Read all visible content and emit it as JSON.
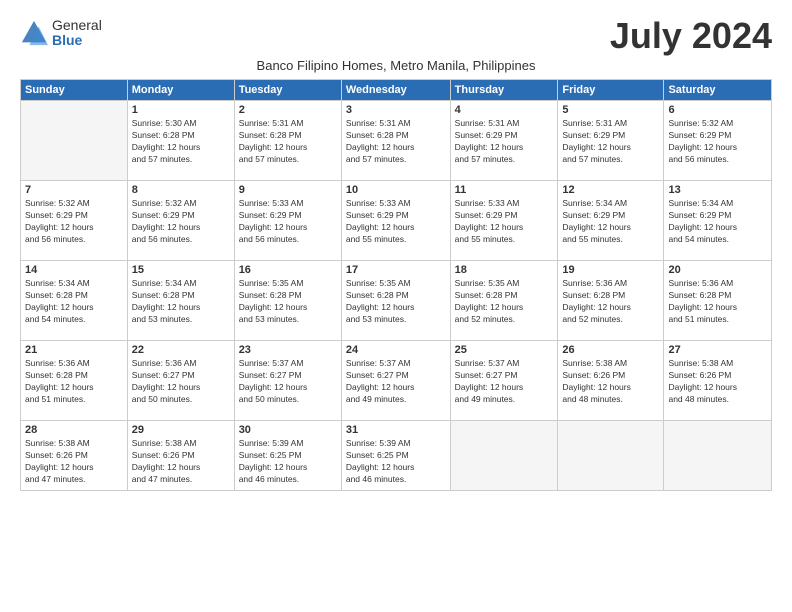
{
  "logo": {
    "general": "General",
    "blue": "Blue"
  },
  "title": "July 2024",
  "subtitle": "Banco Filipino Homes, Metro Manila, Philippines",
  "days_of_week": [
    "Sunday",
    "Monday",
    "Tuesday",
    "Wednesday",
    "Thursday",
    "Friday",
    "Saturday"
  ],
  "weeks": [
    [
      {
        "day": "",
        "info": ""
      },
      {
        "day": "1",
        "info": "Sunrise: 5:30 AM\nSunset: 6:28 PM\nDaylight: 12 hours\nand 57 minutes."
      },
      {
        "day": "2",
        "info": "Sunrise: 5:31 AM\nSunset: 6:28 PM\nDaylight: 12 hours\nand 57 minutes."
      },
      {
        "day": "3",
        "info": "Sunrise: 5:31 AM\nSunset: 6:28 PM\nDaylight: 12 hours\nand 57 minutes."
      },
      {
        "day": "4",
        "info": "Sunrise: 5:31 AM\nSunset: 6:29 PM\nDaylight: 12 hours\nand 57 minutes."
      },
      {
        "day": "5",
        "info": "Sunrise: 5:31 AM\nSunset: 6:29 PM\nDaylight: 12 hours\nand 57 minutes."
      },
      {
        "day": "6",
        "info": "Sunrise: 5:32 AM\nSunset: 6:29 PM\nDaylight: 12 hours\nand 56 minutes."
      }
    ],
    [
      {
        "day": "7",
        "info": "Sunrise: 5:32 AM\nSunset: 6:29 PM\nDaylight: 12 hours\nand 56 minutes."
      },
      {
        "day": "8",
        "info": "Sunrise: 5:32 AM\nSunset: 6:29 PM\nDaylight: 12 hours\nand 56 minutes."
      },
      {
        "day": "9",
        "info": "Sunrise: 5:33 AM\nSunset: 6:29 PM\nDaylight: 12 hours\nand 56 minutes."
      },
      {
        "day": "10",
        "info": "Sunrise: 5:33 AM\nSunset: 6:29 PM\nDaylight: 12 hours\nand 55 minutes."
      },
      {
        "day": "11",
        "info": "Sunrise: 5:33 AM\nSunset: 6:29 PM\nDaylight: 12 hours\nand 55 minutes."
      },
      {
        "day": "12",
        "info": "Sunrise: 5:34 AM\nSunset: 6:29 PM\nDaylight: 12 hours\nand 55 minutes."
      },
      {
        "day": "13",
        "info": "Sunrise: 5:34 AM\nSunset: 6:29 PM\nDaylight: 12 hours\nand 54 minutes."
      }
    ],
    [
      {
        "day": "14",
        "info": "Sunrise: 5:34 AM\nSunset: 6:28 PM\nDaylight: 12 hours\nand 54 minutes."
      },
      {
        "day": "15",
        "info": "Sunrise: 5:34 AM\nSunset: 6:28 PM\nDaylight: 12 hours\nand 53 minutes."
      },
      {
        "day": "16",
        "info": "Sunrise: 5:35 AM\nSunset: 6:28 PM\nDaylight: 12 hours\nand 53 minutes."
      },
      {
        "day": "17",
        "info": "Sunrise: 5:35 AM\nSunset: 6:28 PM\nDaylight: 12 hours\nand 53 minutes."
      },
      {
        "day": "18",
        "info": "Sunrise: 5:35 AM\nSunset: 6:28 PM\nDaylight: 12 hours\nand 52 minutes."
      },
      {
        "day": "19",
        "info": "Sunrise: 5:36 AM\nSunset: 6:28 PM\nDaylight: 12 hours\nand 52 minutes."
      },
      {
        "day": "20",
        "info": "Sunrise: 5:36 AM\nSunset: 6:28 PM\nDaylight: 12 hours\nand 51 minutes."
      }
    ],
    [
      {
        "day": "21",
        "info": "Sunrise: 5:36 AM\nSunset: 6:28 PM\nDaylight: 12 hours\nand 51 minutes."
      },
      {
        "day": "22",
        "info": "Sunrise: 5:36 AM\nSunset: 6:27 PM\nDaylight: 12 hours\nand 50 minutes."
      },
      {
        "day": "23",
        "info": "Sunrise: 5:37 AM\nSunset: 6:27 PM\nDaylight: 12 hours\nand 50 minutes."
      },
      {
        "day": "24",
        "info": "Sunrise: 5:37 AM\nSunset: 6:27 PM\nDaylight: 12 hours\nand 49 minutes."
      },
      {
        "day": "25",
        "info": "Sunrise: 5:37 AM\nSunset: 6:27 PM\nDaylight: 12 hours\nand 49 minutes."
      },
      {
        "day": "26",
        "info": "Sunrise: 5:38 AM\nSunset: 6:26 PM\nDaylight: 12 hours\nand 48 minutes."
      },
      {
        "day": "27",
        "info": "Sunrise: 5:38 AM\nSunset: 6:26 PM\nDaylight: 12 hours\nand 48 minutes."
      }
    ],
    [
      {
        "day": "28",
        "info": "Sunrise: 5:38 AM\nSunset: 6:26 PM\nDaylight: 12 hours\nand 47 minutes."
      },
      {
        "day": "29",
        "info": "Sunrise: 5:38 AM\nSunset: 6:26 PM\nDaylight: 12 hours\nand 47 minutes."
      },
      {
        "day": "30",
        "info": "Sunrise: 5:39 AM\nSunset: 6:25 PM\nDaylight: 12 hours\nand 46 minutes."
      },
      {
        "day": "31",
        "info": "Sunrise: 5:39 AM\nSunset: 6:25 PM\nDaylight: 12 hours\nand 46 minutes."
      },
      {
        "day": "",
        "info": ""
      },
      {
        "day": "",
        "info": ""
      },
      {
        "day": "",
        "info": ""
      }
    ]
  ]
}
